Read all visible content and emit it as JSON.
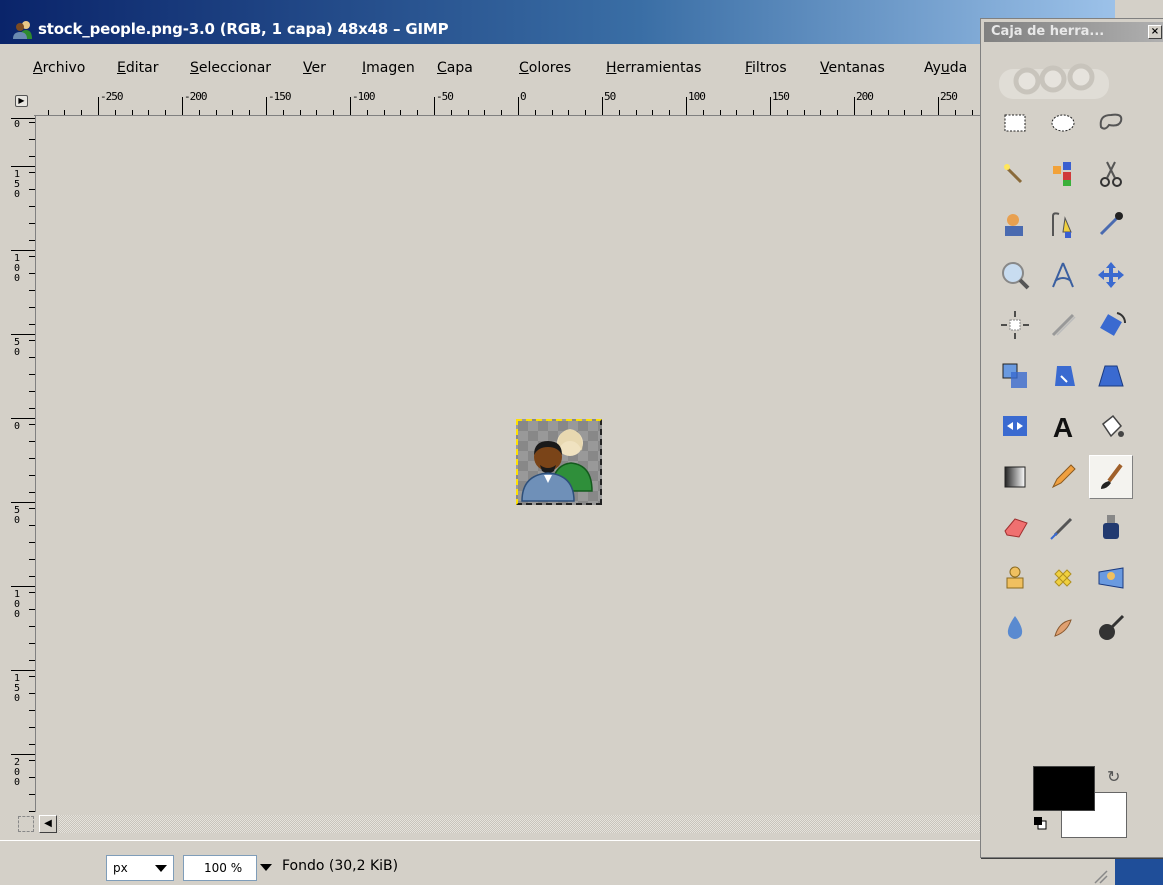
{
  "window": {
    "title": "stock_people.png-3.0 (RGB, 1 capa) 48x48 – GIMP"
  },
  "menubar": {
    "items": [
      {
        "label": "Archivo",
        "mnemonic": "A"
      },
      {
        "label": "Editar",
        "mnemonic": "E"
      },
      {
        "label": "Seleccionar",
        "mnemonic": "S"
      },
      {
        "label": "Ver",
        "mnemonic": "V"
      },
      {
        "label": "Imagen",
        "mnemonic": "I"
      },
      {
        "label": "Capa",
        "mnemonic": "C"
      },
      {
        "label": "Colores",
        "mnemonic": "C"
      },
      {
        "label": "Herramientas",
        "mnemonic": "H"
      },
      {
        "label": "Filtros",
        "mnemonic": "F"
      },
      {
        "label": "Ventanas",
        "mnemonic": "V"
      },
      {
        "label": "Ayuda",
        "mnemonic": "u"
      }
    ]
  },
  "hruler": {
    "labels": [
      "-250",
      "-200",
      "-150",
      "-100",
      "-50",
      "0",
      "50",
      "100",
      "150",
      "200",
      "250"
    ]
  },
  "vruler": {
    "labels": [
      "0",
      "150",
      "100",
      "50",
      "0",
      "50",
      "100",
      "150",
      "200"
    ]
  },
  "statusbar": {
    "unit": "px",
    "zoom": "100 %",
    "layer_info": "Fondo (30,2 KiB)"
  },
  "toolbox": {
    "title": "Caja de herra...",
    "tools": [
      {
        "name": "rect-select-icon"
      },
      {
        "name": "ellipse-select-icon"
      },
      {
        "name": "free-select-icon"
      },
      {
        "name": "fuzzy-select-icon"
      },
      {
        "name": "select-by-color-icon"
      },
      {
        "name": "scissors-icon"
      },
      {
        "name": "foreground-select-icon"
      },
      {
        "name": "paths-icon"
      },
      {
        "name": "color-picker-icon"
      },
      {
        "name": "zoom-icon"
      },
      {
        "name": "measure-icon"
      },
      {
        "name": "move-icon"
      },
      {
        "name": "align-icon"
      },
      {
        "name": "crop-icon"
      },
      {
        "name": "rotate-icon"
      },
      {
        "name": "scale-icon"
      },
      {
        "name": "shear-icon"
      },
      {
        "name": "perspective-icon"
      },
      {
        "name": "flip-icon"
      },
      {
        "name": "text-icon"
      },
      {
        "name": "bucket-fill-icon"
      },
      {
        "name": "blend-icon"
      },
      {
        "name": "pencil-icon"
      },
      {
        "name": "paintbrush-icon",
        "active": true
      },
      {
        "name": "eraser-icon"
      },
      {
        "name": "airbrush-icon"
      },
      {
        "name": "ink-icon"
      },
      {
        "name": "clone-icon"
      },
      {
        "name": "heal-icon"
      },
      {
        "name": "perspective-clone-icon"
      },
      {
        "name": "blur-icon"
      },
      {
        "name": "smudge-icon"
      },
      {
        "name": "dodge-burn-icon"
      }
    ],
    "text_tool_glyph": "A",
    "foreground_color": "#000000",
    "background_color": "#ffffff"
  }
}
